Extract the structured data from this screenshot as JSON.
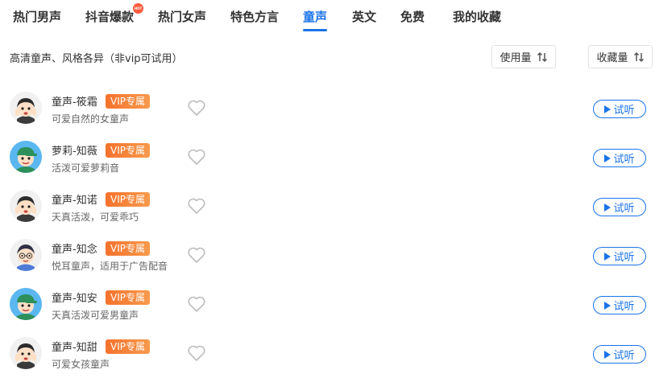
{
  "tabs": [
    {
      "label": "热门男声",
      "active": false
    },
    {
      "label": "抖音爆款",
      "active": false,
      "badge": "hot"
    },
    {
      "label": "热门女声",
      "active": false
    },
    {
      "label": "特色方言",
      "active": false
    },
    {
      "label": "童声",
      "active": true
    },
    {
      "label": "英文",
      "active": false
    },
    {
      "label": "免费",
      "active": false
    },
    {
      "label": "我的收藏",
      "active": false
    }
  ],
  "subtitle": "高清童声、风格各异（非vip可试用）",
  "sort": {
    "usage_label": "使用量",
    "favorites_label": "收藏量"
  },
  "voices": [
    {
      "name": "童声-筱霜",
      "badge": "VIP专属",
      "desc": "可爱自然的女童声",
      "avatar": "girl-avatar",
      "listen": "试听"
    },
    {
      "name": "萝莉-知薇",
      "badge": "VIP专属",
      "desc": "活泼可爱萝莉音",
      "avatar": "boy-cap-avatar",
      "listen": "试听"
    },
    {
      "name": "童声-知诺",
      "badge": "VIP专属",
      "desc": "天真活泼，可爱乖巧",
      "avatar": "girl-avatar",
      "listen": "试听"
    },
    {
      "name": "童声-知念",
      "badge": "VIP专属",
      "desc": "悦耳童声，适用于广告配音",
      "avatar": "glasses-kid-avatar",
      "listen": "试听"
    },
    {
      "name": "童声-知安",
      "badge": "VIP专属",
      "desc": "天真活泼可爱男童声",
      "avatar": "boy-cap-avatar",
      "listen": "试听"
    },
    {
      "name": "童声-知甜",
      "badge": "VIP专属",
      "desc": "可爱女孩童声",
      "avatar": "girl-avatar",
      "listen": "试听"
    }
  ],
  "colors": {
    "accent": "#1a73e8",
    "vip": "#f5722d",
    "hot": "#ff5a3c"
  }
}
